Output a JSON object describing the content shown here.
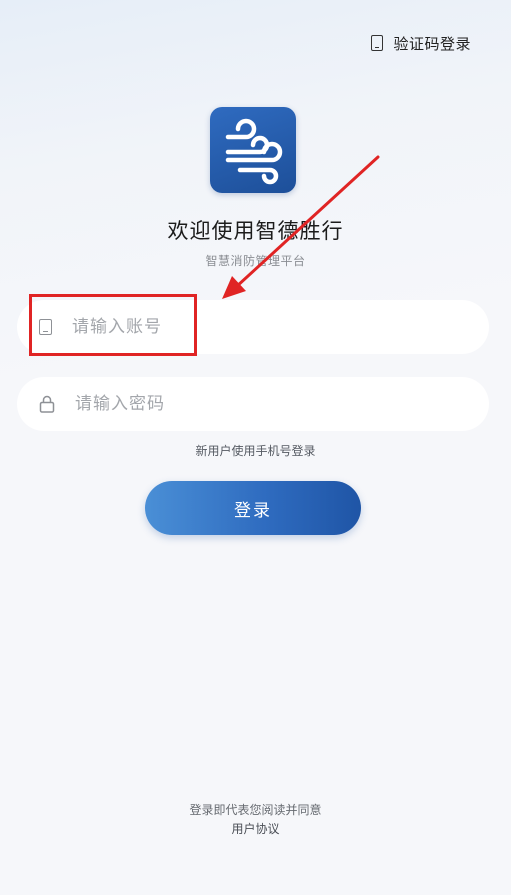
{
  "header": {
    "sms_login_label": "验证码登录",
    "sms_login_icon": "phone-icon"
  },
  "app": {
    "logo_icon": "wind-logo-icon",
    "title": "欢迎使用智德胜行",
    "subtitle": "智慧消防管理平台",
    "brand_color": "#2660b0"
  },
  "form": {
    "account_placeholder": "请输入账号",
    "account_value": "",
    "password_placeholder": "请输入密码",
    "password_value": "",
    "new_user_link": "新用户使用手机号登录",
    "login_button": "登录"
  },
  "footer": {
    "agreement_text": "登录即代表您阅读并同意",
    "agreement_link": "用户协议"
  },
  "annotation": {
    "highlight_color": "#e02424"
  }
}
